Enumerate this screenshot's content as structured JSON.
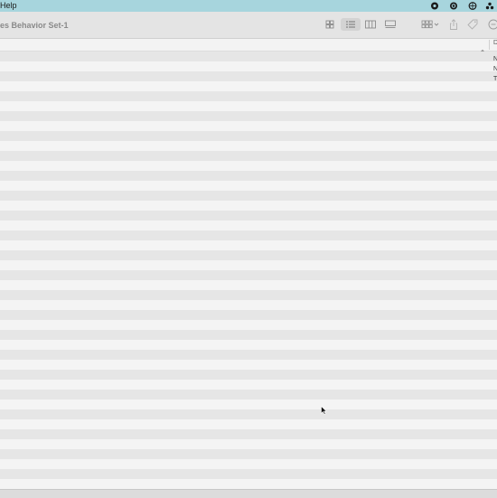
{
  "menubar": {
    "help_label": "Help",
    "icons": [
      "record-icon",
      "chatgpt-icon",
      "vpn-icon",
      "dropbox-icon"
    ]
  },
  "window": {
    "title": "es Behavior Set-1"
  },
  "toolbar": {
    "views": [
      "icon-view",
      "list-view",
      "column-view",
      "gallery-view"
    ],
    "active_view": "list-view",
    "group_by": "group-by-icon",
    "share": "share-icon",
    "tag": "tag-icon",
    "more": "more-icon"
  },
  "list_header": {
    "second_column": "D"
  },
  "rows": [
    {
      "col2": "N"
    },
    {
      "col2": "N"
    },
    {
      "col2": "T"
    }
  ]
}
